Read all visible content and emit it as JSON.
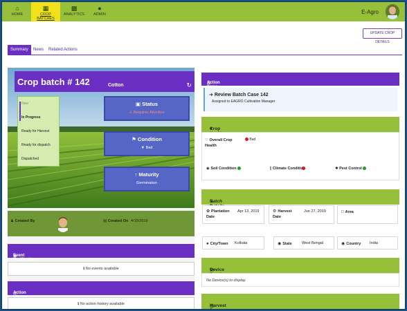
{
  "nav": {
    "items": [
      {
        "label": "HOME",
        "icon": "home-icon"
      },
      {
        "label": "CROP BATCHES",
        "icon": "grid-icon"
      },
      {
        "label": "ANALYTICS",
        "icon": "bar-chart-icon"
      },
      {
        "label": "ADMIN",
        "icon": "user-icon"
      }
    ],
    "active_index": 1,
    "brand": "E-Agro"
  },
  "update_button": "UPDATE CROP DETAILS",
  "tabs": [
    "Summary",
    "News",
    "Related Actions"
  ],
  "hero": {
    "batch_title": "Crop batch # 142",
    "crop": "Cotton",
    "stages": [
      "New",
      "In Progress",
      "Ready for Harvest",
      "Ready for dispatch",
      "Dispatched"
    ],
    "current_stage_index": 1,
    "status": {
      "title": "Status",
      "value": "Requires Attention"
    },
    "condition": {
      "title": "Condition",
      "value": "Bad"
    },
    "maturity": {
      "title": "Maturity",
      "value": "Germination"
    }
  },
  "created": {
    "by_label": "Created By",
    "on_label": "Created On",
    "on_value": "4/15/2019"
  },
  "event_notifications": {
    "title": "Event Notifications",
    "empty": "No events available"
  },
  "action_history": {
    "title": "Action History",
    "empty": "No action history available"
  },
  "action_items": {
    "title": "Action Items",
    "item_title": "Review Batch Case 142",
    "item_sub": "Assigned to EAGRO Cultivation Manager"
  },
  "crop_health": {
    "title": "Crop Health Status",
    "overall_label": "Overall Crop Health",
    "overall_value": "Bad",
    "soil": "Soil Condition",
    "climate": "Climate Condition",
    "pest": "Pest Control"
  },
  "batch_details": {
    "title": "Batch Details",
    "plantation_label": "Plantation Date",
    "plantation_value": "Apr 13, 2019",
    "harvest_label": "Harvest Date",
    "harvest_value": "Jun 27, 2019",
    "area_label": "Area",
    "city_label": "City/Town",
    "city_value": "Kolkata",
    "state_label": "State",
    "state_value": "West Bengal",
    "country_label": "Country",
    "country_value": "India"
  },
  "device_details": {
    "title": "Device Details",
    "empty": "No Device(s) to display."
  },
  "harvest_parameters": {
    "title": "Harvest Parameters"
  },
  "colors": {
    "purple": "#6a2fc2",
    "green": "#96c03a",
    "yellow": "#f0e11a"
  }
}
